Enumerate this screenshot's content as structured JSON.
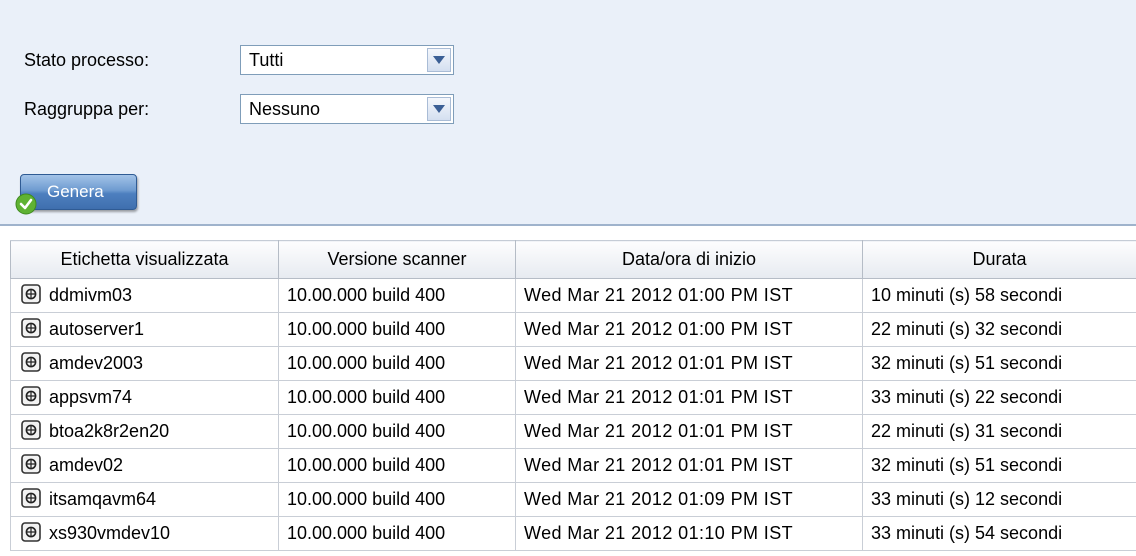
{
  "filters": {
    "stato_label": "Stato processo:",
    "stato_value": "Tutti",
    "raggruppa_label": "Raggruppa per:",
    "raggruppa_value": "Nessuno",
    "generate_label": "Genera"
  },
  "table": {
    "headers": [
      "Etichetta visualizzata",
      "Versione scanner",
      "Data/ora di inizio",
      "Durata"
    ],
    "rows": [
      [
        "ddmivm03",
        "10.00.000 build 400",
        "Wed Mar 21 2012 01:00 PM IST",
        "10 minuti (s) 58 secondi"
      ],
      [
        "autoserver1",
        "10.00.000 build 400",
        "Wed Mar 21 2012 01:00 PM IST",
        "22 minuti (s) 32 secondi"
      ],
      [
        "amdev2003",
        "10.00.000 build 400",
        "Wed Mar 21 2012 01:01 PM IST",
        "32 minuti (s) 51 secondi"
      ],
      [
        "appsvm74",
        "10.00.000 build 400",
        "Wed Mar 21 2012 01:01 PM IST",
        "33 minuti (s) 22 secondi"
      ],
      [
        "btoa2k8r2en20",
        "10.00.000 build 400",
        "Wed Mar 21 2012 01:01 PM IST",
        "22 minuti (s) 31 secondi"
      ],
      [
        "amdev02",
        "10.00.000 build 400",
        "Wed Mar 21 2012 01:01 PM IST",
        "32 minuti (s) 51 secondi"
      ],
      [
        "itsamqavm64",
        "10.00.000 build 400",
        "Wed Mar 21 2012 01:09 PM IST",
        "33 minuti (s) 12 secondi"
      ],
      [
        "xs930vmdev10",
        "10.00.000 build 400",
        "Wed Mar 21 2012 01:10 PM IST",
        "33 minuti (s) 54 secondi"
      ]
    ]
  },
  "icons": {
    "dropdown": "chevron-down-icon",
    "generate": "checkmark-icon",
    "row": "scanner-node-icon"
  },
  "colors": {
    "panel_bg": "#eaf0f9",
    "button_blue": "#4d7fbf",
    "ok_green": "#5fb233"
  }
}
